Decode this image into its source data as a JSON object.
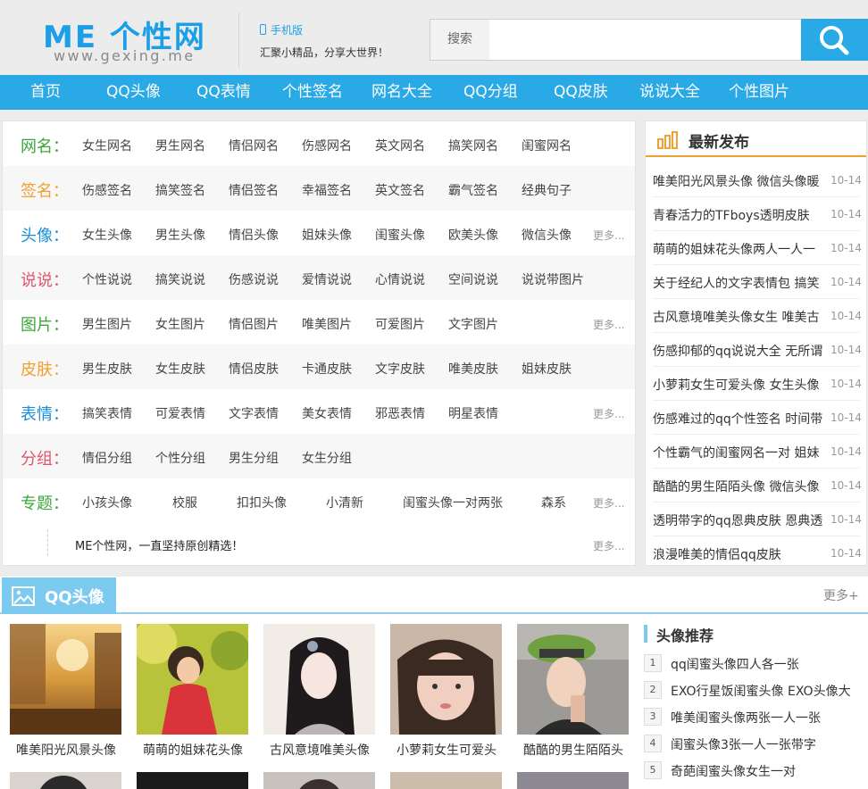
{
  "header": {
    "logo_main": "ME 个性网",
    "logo_sub": "www.gexing.me",
    "mobile": "手机版",
    "slogan": "汇聚小精品，分享大世界！",
    "search_label": "搜索",
    "search_value": ""
  },
  "nav": [
    "首页",
    "QQ头像",
    "QQ表情",
    "个性签名",
    "网名大全",
    "QQ分组",
    "QQ皮肤",
    "说说大全",
    "个性图片"
  ],
  "categories": [
    {
      "label": "网名：",
      "links": [
        "女生网名",
        "男生网名",
        "情侣网名",
        "伤感网名",
        "英文网名",
        "搞笑网名",
        "闺蜜网名"
      ],
      "more": ""
    },
    {
      "label": "签名：",
      "links": [
        "伤感签名",
        "搞笑签名",
        "情侣签名",
        "幸福签名",
        "英文签名",
        "霸气签名",
        "经典句子"
      ],
      "more": ""
    },
    {
      "label": "头像：",
      "links": [
        "女生头像",
        "男生头像",
        "情侣头像",
        "姐妹头像",
        "闺蜜头像",
        "欧美头像",
        "微信头像"
      ],
      "more": "更多..."
    },
    {
      "label": "说说：",
      "links": [
        "个性说说",
        "搞笑说说",
        "伤感说说",
        "爱情说说",
        "心情说说",
        "空间说说",
        "说说带图片"
      ],
      "more": ""
    },
    {
      "label": "图片：",
      "links": [
        "男生图片",
        "女生图片",
        "情侣图片",
        "唯美图片",
        "可爱图片",
        "文字图片"
      ],
      "more": "更多..."
    },
    {
      "label": "皮肤：",
      "links": [
        "男生皮肤",
        "女生皮肤",
        "情侣皮肤",
        "卡通皮肤",
        "文字皮肤",
        "唯美皮肤",
        "姐妹皮肤"
      ],
      "more": ""
    },
    {
      "label": "表情：",
      "links": [
        "搞笑表情",
        "可爱表情",
        "文字表情",
        "美女表情",
        "邪恶表情",
        "明星表情"
      ],
      "more": "更多..."
    },
    {
      "label": "分组：",
      "links": [
        "情侣分组",
        "个性分组",
        "男生分组",
        "女生分组"
      ],
      "more": ""
    },
    {
      "label": "专题：",
      "links": [
        "小孩头像",
        "校服",
        "扣扣头像",
        "小清新",
        "闺蜜头像一对两张",
        "森系"
      ],
      "more": "更多..."
    }
  ],
  "footer_note": "ME个性网，一直坚持原创精选！",
  "footer_more": "更多...",
  "latest": {
    "title": "最新发布",
    "items": [
      {
        "text": "唯美阳光风景头像 微信头像暖",
        "date": "10-14"
      },
      {
        "text": "青春活力的TFboys透明皮肤",
        "date": "10-14"
      },
      {
        "text": "萌萌的姐妹花头像两人一人一",
        "date": "10-14"
      },
      {
        "text": "关于经纪人的文字表情包 搞笑",
        "date": "10-14"
      },
      {
        "text": "古风意境唯美头像女生 唯美古",
        "date": "10-14"
      },
      {
        "text": "伤感抑郁的qq说说大全 无所谓",
        "date": "10-14"
      },
      {
        "text": "小萝莉女生可爱头像 女生头像",
        "date": "10-14"
      },
      {
        "text": "伤感难过的qq个性签名 时间带",
        "date": "10-14"
      },
      {
        "text": "个性霸气的闺蜜网名一对 姐妹",
        "date": "10-14"
      },
      {
        "text": "酷酷的男生陌陌头像 微信头像",
        "date": "10-14"
      },
      {
        "text": "透明带字的qq恩典皮肤 恩典透",
        "date": "10-14"
      },
      {
        "text": "浪漫唯美的情侣qq皮肤",
        "date": "10-14"
      }
    ]
  },
  "qq_section": {
    "title": "QQ头像",
    "more": "更多+",
    "thumbs": [
      {
        "caption": "唯美阳光风景头像"
      },
      {
        "caption": "萌萌的姐妹花头像"
      },
      {
        "caption": "古风意境唯美头像"
      },
      {
        "caption": "小萝莉女生可爱头"
      },
      {
        "caption": "酷酷的男生陌陌头"
      }
    ],
    "rec_title": "头像推荐",
    "rec_items": [
      {
        "num": "1",
        "text": "qq闺蜜头像四人各一张"
      },
      {
        "num": "2",
        "text": "EXO行星饭闺蜜头像 EXO头像大"
      },
      {
        "num": "3",
        "text": "唯美闺蜜头像两张一人一张"
      },
      {
        "num": "4",
        "text": "闺蜜头像3张一人一张带字"
      },
      {
        "num": "5",
        "text": "奇葩闺蜜头像女生一对"
      }
    ]
  },
  "colors": {
    "brand_blue": "#29a9e6",
    "label_green": "#3aa63a",
    "label_orange": "#f0a030",
    "label_blue": "#1a8fd8",
    "label_red": "#e0576a"
  }
}
